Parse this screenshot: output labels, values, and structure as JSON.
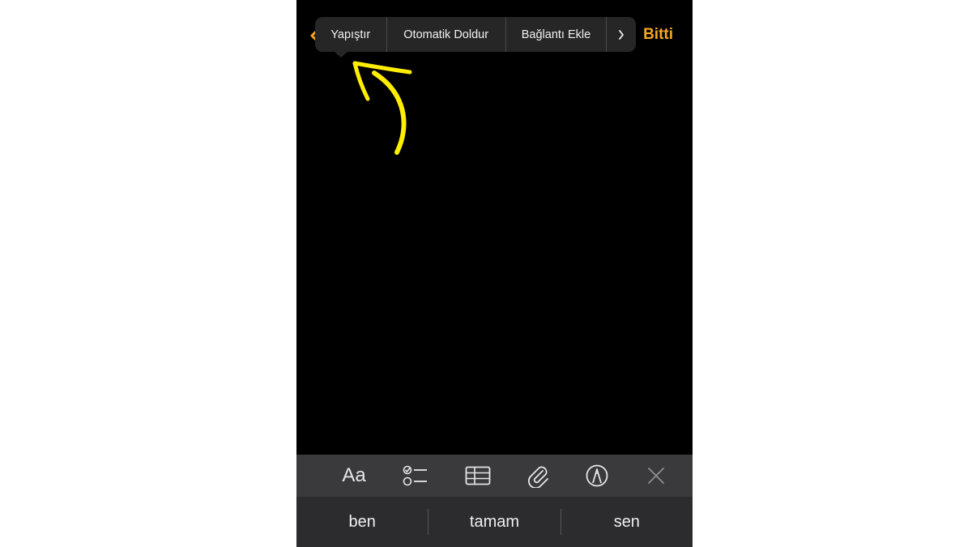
{
  "nav": {
    "back_icon": "chevron-left-icon",
    "done_label": "Bitti",
    "accent_color": "#f5a623"
  },
  "edit_menu": {
    "items": [
      "Yapıştır",
      "Otomatik Doldur",
      "Bağlantı Ekle"
    ],
    "more_icon": "chevron-right-icon"
  },
  "annotation": {
    "icon": "arrow-icon",
    "color": "#ffee00"
  },
  "toolbar": {
    "format_label": "Aa",
    "icons": [
      "checklist-icon",
      "table-icon",
      "paperclip-icon",
      "markup-icon",
      "close-icon"
    ]
  },
  "suggestions": [
    "ben",
    "tamam",
    "sen"
  ]
}
